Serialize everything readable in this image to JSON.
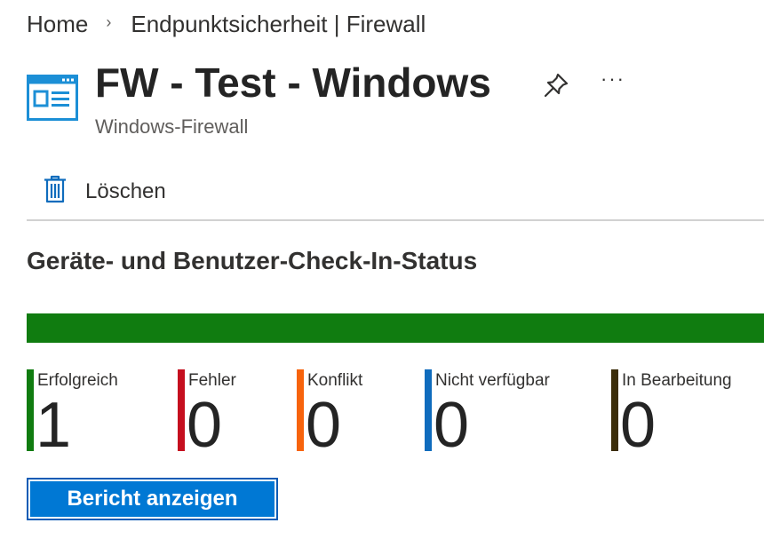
{
  "breadcrumb": {
    "items": [
      "Home",
      "Endpunktsicherheit | Firewall"
    ]
  },
  "header": {
    "icon": "windows-firewall-icon",
    "title": "FW - Test - Windows",
    "subtitle": "Windows-Firewall",
    "pin_icon": "pin-icon",
    "more_label": "···"
  },
  "toolbar": {
    "delete_icon": "trash-icon",
    "delete_label": "Löschen"
  },
  "checkin": {
    "title": "Geräte- und Benutzer-Check-In-Status",
    "progress": {
      "success_fraction": 1.0,
      "color": "#107c10"
    },
    "stats": [
      {
        "label": "Erfolgreich",
        "value": "1",
        "color": "#107c10"
      },
      {
        "label": "Fehler",
        "value": "0",
        "color": "#c50f1f"
      },
      {
        "label": "Konflikt",
        "value": "0",
        "color": "#f7630c"
      },
      {
        "label": "Nicht verfügbar",
        "value": "0",
        "color": "#0f6cbd"
      },
      {
        "label": "In Bearbeitung",
        "value": "0",
        "color": "#3b2d0a"
      }
    ],
    "report_button_label": "Bericht anzeigen"
  }
}
